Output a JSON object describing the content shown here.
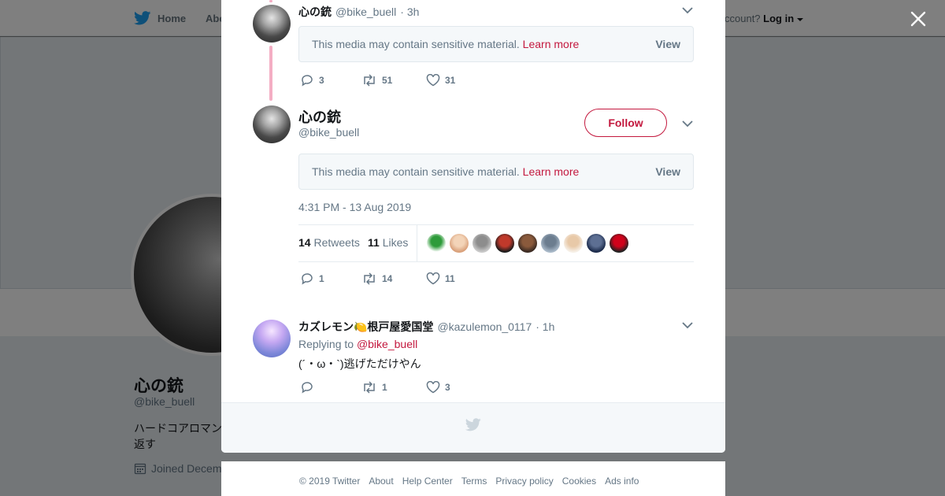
{
  "background": {
    "nav": {
      "home": "Home",
      "about": "Abo",
      "account_prompt": "ccount?",
      "login": "Log in"
    },
    "profile": {
      "name": "心の銃",
      "handle": "@bike_buell",
      "bio": "ハードコアロマン 返す",
      "joined": "Joined Decem"
    }
  },
  "thread": {
    "parent_tweet": {
      "name": "心の銃",
      "handle": "@bike_buell",
      "time": "· 3h",
      "sensitive_msg": "This media may contain sensitive material.",
      "learn_more": "Learn more",
      "view": "View",
      "replies": "3",
      "retweets": "51",
      "likes": "31"
    },
    "main_tweet": {
      "name": "心の銃",
      "handle": "@bike_buell",
      "follow": "Follow",
      "sensitive_msg": "This media may contain sensitive material.",
      "learn_more": "Learn more",
      "view": "View",
      "timestamp": "4:31 PM - 13 Aug 2019",
      "retweet_count": "14",
      "retweet_label": "Retweets",
      "like_count": "11",
      "like_label": "Likes",
      "likers": [
        {
          "color": "#ffffff",
          "accent": "#2e9b3a"
        },
        {
          "color": "#d9a07a",
          "accent": "#f3d4b8"
        },
        {
          "color": "#c9c9c9",
          "accent": "#8d8d8d"
        },
        {
          "color": "#1c1c1c",
          "accent": "#c0392b"
        },
        {
          "color": "#3a2a22",
          "accent": "#8a5a3c"
        },
        {
          "color": "#a8b8c8",
          "accent": "#6c7d8f"
        },
        {
          "color": "#f6efe6",
          "accent": "#e8c9a8"
        },
        {
          "color": "#1b2a4a",
          "accent": "#5d6f93"
        },
        {
          "color": "#222222",
          "accent": "#d0021b"
        }
      ],
      "replies": "1",
      "retweets": "14",
      "likes": "11"
    },
    "reply_tweet": {
      "name": "カズレモン🍋根戸屋愛国堂",
      "handle": "@kazulemon_0117",
      "time": "· 1h",
      "replying_to_prefix": "Replying to",
      "replying_to_handle": "@bike_buell",
      "text": "(´・ω・`)逃げただけやん",
      "replies": "",
      "retweets": "1",
      "likes": "3"
    }
  },
  "footer": {
    "copyright": "© 2019 Twitter",
    "links": [
      "About",
      "Help Center",
      "Terms",
      "Privacy policy",
      "Cookies",
      "Ads info"
    ]
  },
  "colors": {
    "accent": "#c3183e",
    "thread_line": "#f4aec4",
    "muted": "#657786",
    "text": "#14171a"
  }
}
